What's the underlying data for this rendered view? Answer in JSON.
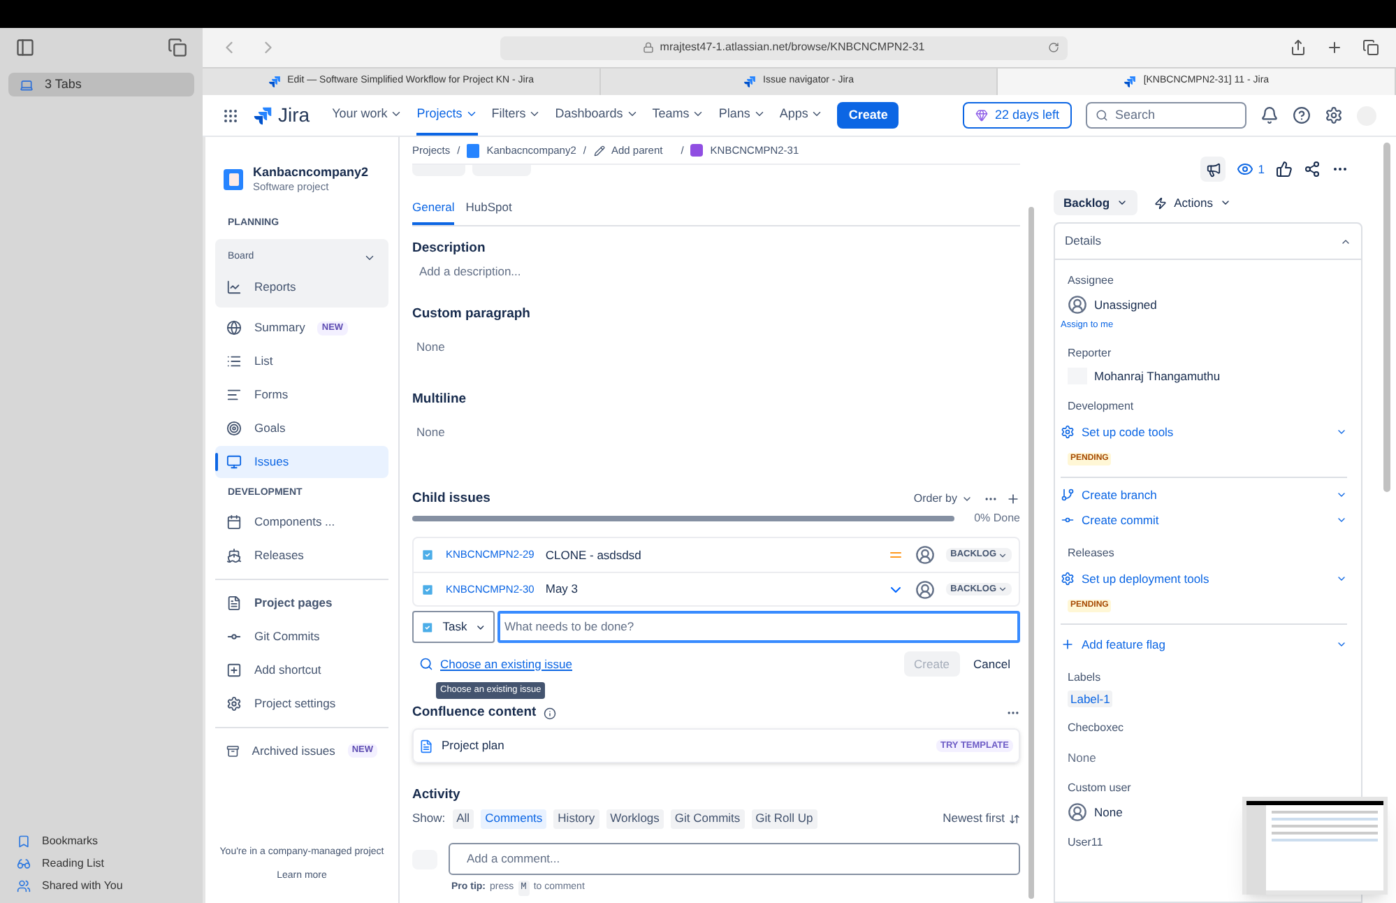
{
  "safari_sidebar": {
    "tab_groups": [
      {
        "label": "3 Tabs",
        "selected": true
      }
    ],
    "links": [
      "Bookmarks",
      "Reading List",
      "Shared with You"
    ]
  },
  "address_bar": {
    "url": "mrajtest47-1.atlassian.net/browse/KNBCNCMPN2-31"
  },
  "tabs": [
    {
      "title": "Edit — Software Simplified Workflow for Project KN - Jira",
      "selected": false
    },
    {
      "title": "Issue navigator - Jira",
      "selected": false
    },
    {
      "title": "[KNBCNCMPN2-31] 11 - Jira",
      "selected": true
    }
  ],
  "jira_nav": {
    "logo": "Jira",
    "menu": [
      {
        "label": "Your work",
        "selected": false
      },
      {
        "label": "Projects",
        "selected": true
      },
      {
        "label": "Filters",
        "selected": false
      },
      {
        "label": "Dashboards",
        "selected": false
      },
      {
        "label": "Teams",
        "selected": false
      },
      {
        "label": "Plans",
        "selected": false
      },
      {
        "label": "Apps",
        "selected": false
      }
    ],
    "create": "Create",
    "trial": "22 days left",
    "search_placeholder": "Search"
  },
  "project_sidebar": {
    "name": "Kanbacncompany2",
    "type": "Software project",
    "planning": {
      "heading": "PLANNING",
      "board": {
        "label": "Board",
        "expanded": true,
        "children": [
          {
            "label": "Reports",
            "selected": false
          }
        ]
      },
      "items": [
        {
          "label": "Summary",
          "badge": "NEW",
          "selected": false
        },
        {
          "label": "List",
          "selected": false
        },
        {
          "label": "Forms",
          "selected": false
        },
        {
          "label": "Goals",
          "selected": false
        },
        {
          "label": "Issues",
          "selected": true
        }
      ]
    },
    "development": {
      "heading": "DEVELOPMENT",
      "items": [
        {
          "label": "Components ...",
          "selected": false
        },
        {
          "label": "Releases",
          "selected": false
        }
      ]
    },
    "more": [
      {
        "label": "Project pages",
        "selected": false
      },
      {
        "label": "Git Commits",
        "selected": false
      },
      {
        "label": "Add shortcut",
        "selected": false
      },
      {
        "label": "Project settings",
        "selected": false
      }
    ],
    "archived": {
      "label": "Archived issues",
      "badge": "NEW",
      "selected": false
    },
    "footer": {
      "text": "You're in a company-managed project",
      "link": "Learn more"
    }
  },
  "issue": {
    "breadcrumbs": [
      {
        "label": "Projects",
        "separator": "/"
      },
      {
        "label": "Kanbacncompany2",
        "separator": "/"
      },
      {
        "label": "Add parent",
        "separator": "/"
      },
      {
        "label": "KNBCNCMPN2-31"
      }
    ],
    "tabs": [
      {
        "label": "General",
        "selected": true
      },
      {
        "label": "HubSpot",
        "selected": false
      }
    ],
    "fields": [
      {
        "label": "Description",
        "value": "Add a description..."
      },
      {
        "label": "Custom paragraph",
        "value": "None"
      },
      {
        "label": "Multiline",
        "value": "None"
      }
    ],
    "child_issues": {
      "title": "Child issues",
      "order_by": "Order by",
      "level": 0,
      "progress_text": "0% Done",
      "rows": [
        {
          "key": "KNBCNCMPN2-29",
          "summary": "CLONE - asdsdsd",
          "kind": "medium",
          "status": "BACKLOG"
        },
        {
          "key": "KNBCNCMPN2-30",
          "summary": "May 3",
          "kind": "low",
          "status": "BACKLOG"
        }
      ],
      "new": {
        "type": "Task",
        "placeholder": "What needs to be done?",
        "choose_link": "Choose an existing issue",
        "tooltip": "Choose an existing issue",
        "create": {
          "label": "Create",
          "disabled": true
        },
        "cancel": "Cancel"
      }
    },
    "confluence": {
      "title": "Confluence content",
      "item": "Project plan",
      "badge": "TRY TEMPLATE"
    },
    "activity": {
      "title": "Activity",
      "show": "Show:",
      "filters": [
        {
          "label": "All",
          "selected": false
        },
        {
          "label": "Comments",
          "selected": true
        },
        {
          "label": "History",
          "selected": false
        },
        {
          "label": "Worklogs",
          "selected": false
        },
        {
          "label": "Git Commits",
          "selected": false
        },
        {
          "label": "Git Roll Up",
          "selected": false
        }
      ],
      "sort": "Newest first",
      "comment_placeholder": "Add a comment...",
      "pro_tip": {
        "label": "Pro tip:",
        "before": "press",
        "key": "M",
        "after": "to comment"
      }
    }
  },
  "side_panel": {
    "watchers": "1",
    "status": "Backlog",
    "actions": "Actions",
    "details": {
      "title": "Details",
      "expanded": true,
      "items": [
        {
          "kind": "label",
          "text": "Assignee"
        },
        {
          "kind": "user",
          "text": "Unassigned"
        },
        {
          "kind": "link",
          "text": "Assign to me"
        },
        {
          "kind": "label",
          "text": "Reporter"
        },
        {
          "kind": "reporter",
          "text": "Mohanraj Thangamuthu"
        },
        {
          "kind": "label",
          "text": "Development"
        },
        {
          "kind": "setup",
          "text": "Set up code tools"
        },
        {
          "kind": "lozenge",
          "text": "PENDING"
        },
        {
          "kind": "divider"
        },
        {
          "kind": "branch",
          "text": "Create branch"
        },
        {
          "kind": "commit",
          "text": "Create commit"
        },
        {
          "kind": "label",
          "text": "Releases"
        },
        {
          "kind": "setup",
          "text": "Set up deployment tools"
        },
        {
          "kind": "lozenge",
          "text": "PENDING"
        },
        {
          "kind": "divider"
        },
        {
          "kind": "add",
          "text": "Add feature flag"
        },
        {
          "kind": "label",
          "text": "Labels"
        },
        {
          "kind": "tag",
          "text": "Label-1"
        },
        {
          "kind": "label",
          "text": "Checboxec"
        },
        {
          "kind": "value",
          "text": "None"
        },
        {
          "kind": "label",
          "text": "Custom user"
        },
        {
          "kind": "user",
          "text": "None"
        },
        {
          "kind": "label",
          "text": "User11"
        }
      ]
    }
  }
}
